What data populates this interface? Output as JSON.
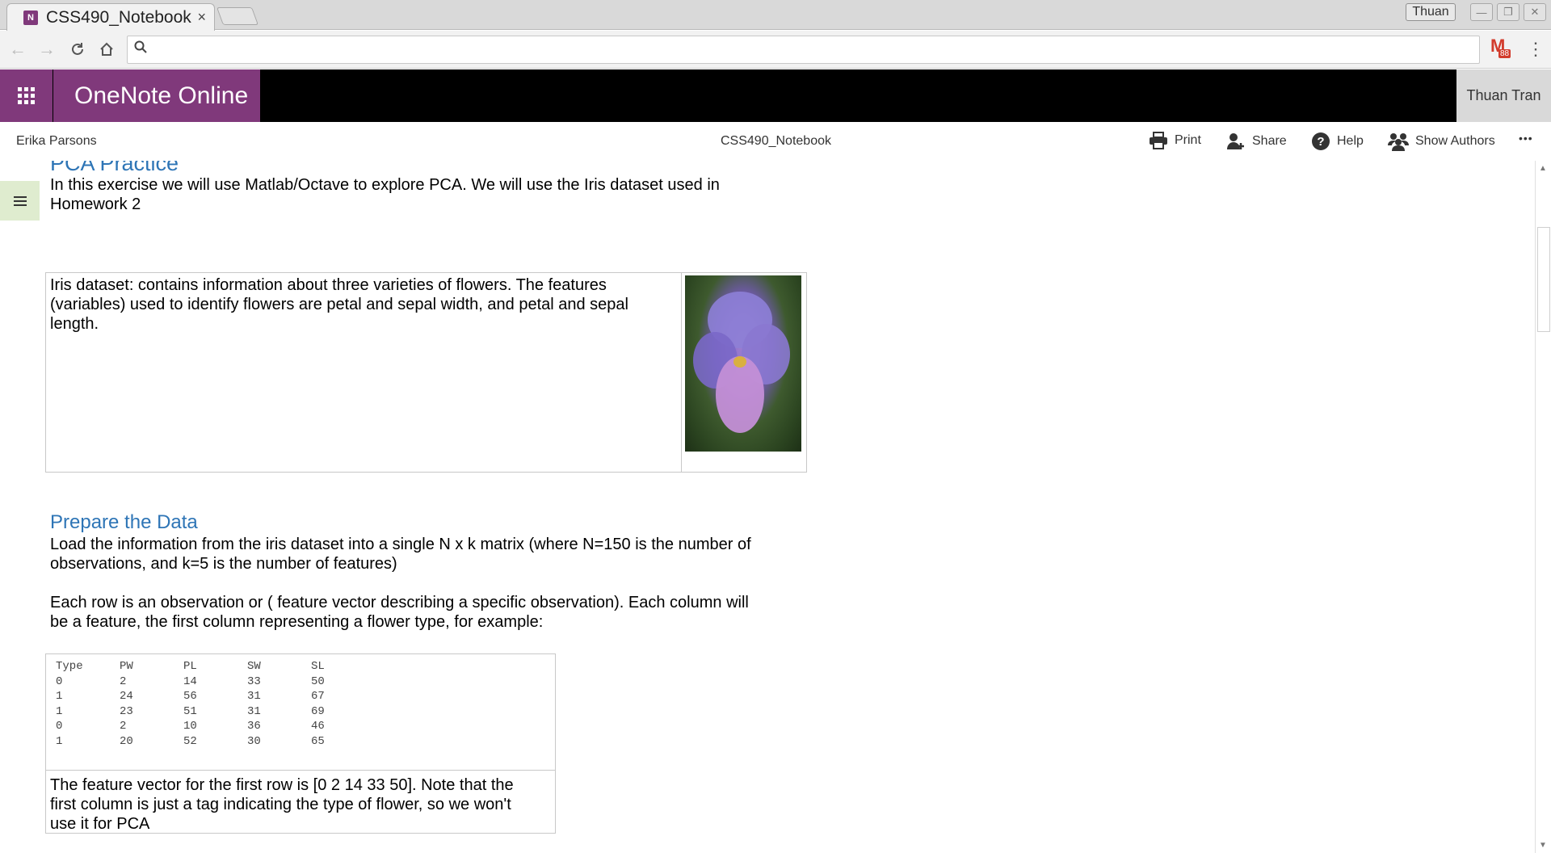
{
  "browser": {
    "tab_title": "CSS490_Notebook",
    "tab_close": "×",
    "tab_favicon": "N",
    "profile_name": "Thuan",
    "gmail_count": "88",
    "search_icon": "search-icon",
    "omnibox_value": ""
  },
  "onenote": {
    "app_name": "OneNote Online",
    "user_name": "Thuan Tran",
    "brand_color": "#80397b"
  },
  "commandbar": {
    "owner": "Erika Parsons",
    "notebook": "CSS490_Notebook",
    "print": "Print",
    "share": "Share",
    "help": "Help",
    "show_authors": "Show Authors",
    "more": "•••"
  },
  "page": {
    "title": "PCA Practice",
    "intro_line1": "In this exercise we will use Matlab/Octave to explore PCA.  We will use the Iris dataset used in",
    "intro_line2": "Homework 2",
    "iris_text": "Iris dataset:  contains information about three varieties of flowers.   The features (variables) used to identify flowers are petal and sepal width, and petal  and sepal length.",
    "prepare_heading": "Prepare the Data",
    "prepare_p1_line1": "Load the information from the iris dataset into a single N x k matrix  (where N=150 is the number of",
    "prepare_p1_line2": "observations, and k=5 is the number of features)",
    "prepare_p2_line1": "Each row is an observation or ( feature vector describing a specific observation).  Each column will",
    "prepare_p2_line2": "be a feature, the first column representing a flower type, for example:",
    "table_headers": [
      "Type",
      "PW",
      "PL",
      "SW",
      "SL"
    ],
    "table_rows": [
      [
        "0",
        "2",
        "14",
        "33",
        "50"
      ],
      [
        "1",
        "24",
        "56",
        "31",
        "67"
      ],
      [
        "1",
        "23",
        "51",
        "31",
        "69"
      ],
      [
        "0",
        "2",
        "10",
        "36",
        "46"
      ],
      [
        "1",
        "20",
        "52",
        "30",
        "65"
      ]
    ],
    "table_note": "The feature vector for the first row is [0  2   14    33    50].  Note that the first column is just a tag indicating the type of flower, so we won't use it for PCA"
  }
}
